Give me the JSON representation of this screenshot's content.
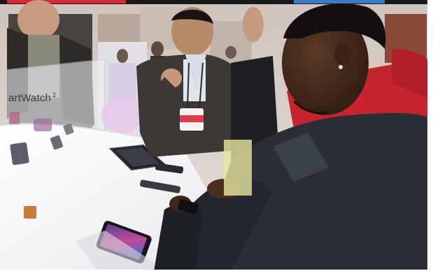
{
  "image": {
    "kind": "photo",
    "signage": {
      "product_name": "artWatch",
      "product_number": "2"
    },
    "colors": {
      "table": "#f4f4f6",
      "hoodie_red": "#c8242e",
      "jacket": "#2a2f36",
      "suit": "#3f3c3a",
      "lanyard_badge": "#e23a4a",
      "background_wall": "#d9d4d0"
    }
  }
}
